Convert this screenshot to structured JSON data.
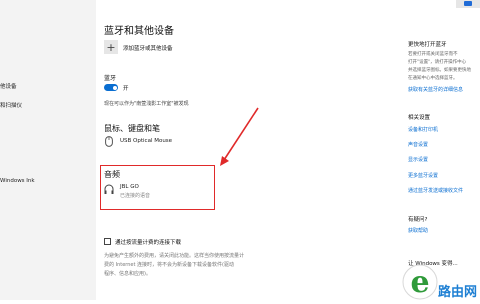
{
  "sidebar": {
    "items": [
      {
        "label": "他设备"
      },
      {
        "label": "和扫描仪"
      },
      {
        "label": "Windows Ink"
      }
    ]
  },
  "main": {
    "page_title": "蓝牙和其他设备",
    "add_device_label": "添加蓝牙或其他设备",
    "bluetooth_heading": "蓝牙",
    "toggle_state": "开",
    "discoverable_text": "现在可以作为\"南萱浅影工作室\"被发现",
    "mouse_section": {
      "title": "鼠标、键盘和笔",
      "device_name": "USB Optical Mouse"
    },
    "audio_section": {
      "title": "音频",
      "device_name": "JBL GO",
      "device_status": "已连接的语音"
    },
    "metered_label": "通过按流量计费的连接下载",
    "metered_desc": [
      "为避免产生额外的费用，请关闭此功能。这样当你使用按流量计",
      "费的 Internet 连接时，将不会为新设备下载设备软件(驱动",
      "程序、信息和应用)。"
    ]
  },
  "right_panel": {
    "section1_head": "更快地打开蓝牙",
    "section1_lines": [
      "若要打开或关闭蓝牙而不",
      "打开\"设置\"，请打开操作中心",
      "并选择蓝牙图标。如果要更快地",
      "在通知中心中选择蓝牙。"
    ],
    "section1_link": "获取有关蓝牙的详细信息",
    "related_head": "相关设置",
    "related_links": [
      "设备和打印机",
      "声音设置",
      "显示设置",
      "更多蓝牙设置",
      "通过蓝牙发送或接收文件"
    ],
    "help_head": "有疑问?",
    "help_link": "获取帮助",
    "bottom_text": "让 Windows 变得..."
  },
  "watermark": {
    "brand_letter": "e",
    "brand_text": "路由网"
  },
  "colors": {
    "accent": "#0a6ed1",
    "highlight": "#e02a2a",
    "sidebar_bg": "#f3f3f3"
  }
}
